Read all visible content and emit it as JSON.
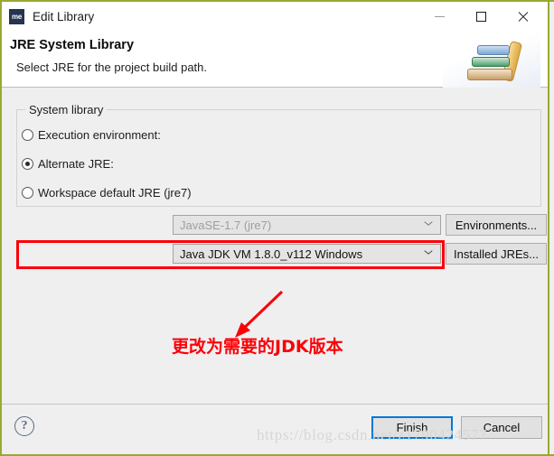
{
  "window": {
    "title": "Edit Library",
    "app_icon_label": "me",
    "controls": {
      "minimize": "minimize-icon",
      "maximize": "maximize-icon",
      "close": "close-icon"
    },
    "border_color": "#9aa832"
  },
  "header": {
    "title": "JRE System Library",
    "description": "Select JRE for the project build path.",
    "art": "books-illustration"
  },
  "group": {
    "legend": "System library",
    "options": [
      {
        "label": "Execution environment:",
        "selected": false,
        "combo_value": "JavaSE-1.7 (jre7)",
        "combo_enabled": false,
        "button": "Environments..."
      },
      {
        "label": "Alternate JRE:",
        "selected": true,
        "combo_value": "Java JDK VM 1.8.0_v112 Windows",
        "combo_enabled": true,
        "button": "Installed JREs..."
      },
      {
        "label": "Workspace default JRE (jre7)",
        "selected": false
      }
    ]
  },
  "annotation": {
    "text": "更改为需要的JDK版本",
    "color": "#fb0007",
    "highlight_color": "#fb0007",
    "arrow": "down-left-arrow-icon"
  },
  "footer": {
    "help": "?",
    "finish_label": "Finish",
    "cancel_label": "Cancel",
    "primary_accent": "#0078d7"
  },
  "watermark": {
    "text": "https://blog.csdn.net/z1790424577"
  }
}
